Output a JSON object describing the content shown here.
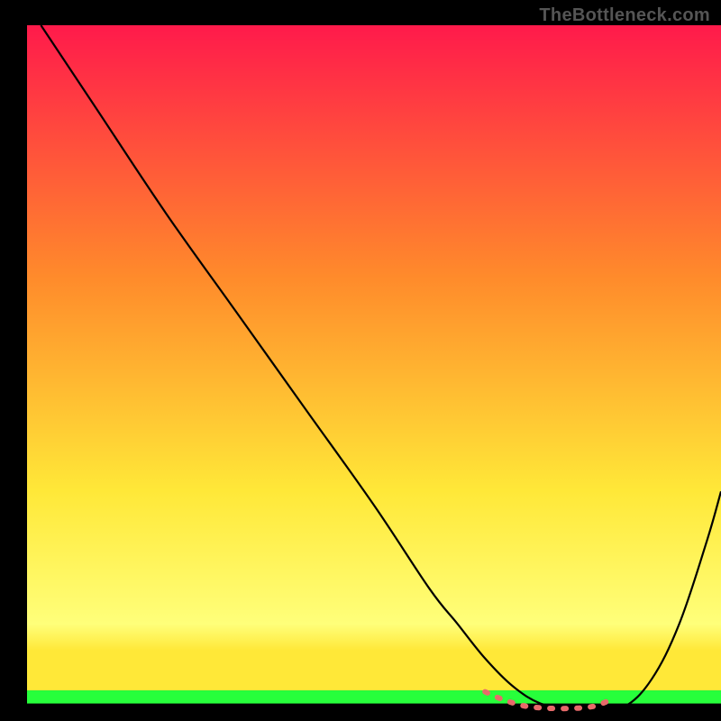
{
  "watermark": "TheBottleneck.com",
  "chart_data": {
    "type": "line",
    "title": "",
    "xlabel": "",
    "ylabel": "",
    "xlim": [
      0,
      100
    ],
    "ylim": [
      0,
      100
    ],
    "background_gradient": {
      "top": "#ff1a4b",
      "mid_upper": "#ff8b2b",
      "mid_lower": "#ffe838",
      "green_band": "#27ff3b",
      "bottom": "#000000"
    },
    "series": [
      {
        "name": "bottleneck-curve",
        "color": "#000000",
        "x": [
          2,
          10,
          20,
          30,
          40,
          50,
          58,
          62,
          66,
          70,
          74,
          78,
          80,
          82,
          86,
          90,
          94,
          98,
          100
        ],
        "values": [
          100,
          88,
          73,
          59,
          45,
          31,
          19,
          14,
          9,
          5,
          2.5,
          1.8,
          1.6,
          1.6,
          2.0,
          6,
          14,
          26,
          33
        ]
      },
      {
        "name": "optimal-band-marker",
        "color": "#e76a6a",
        "x": [
          66,
          68,
          70,
          72,
          74,
          76,
          78,
          80,
          82,
          84
        ],
        "values": [
          4.2,
          3.3,
          2.6,
          2.1,
          1.9,
          1.8,
          1.8,
          1.9,
          2.2,
          3.0
        ]
      }
    ],
    "annotations": []
  }
}
